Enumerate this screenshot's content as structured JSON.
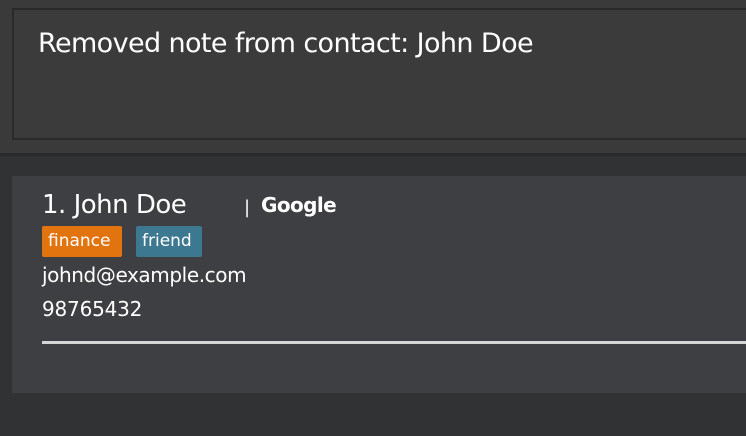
{
  "result": {
    "message": "Removed note from contact: John Doe"
  },
  "person": {
    "index_name": "1. John Doe",
    "separator": "|",
    "company": "Google",
    "tags": [
      {
        "label": "finance",
        "color": "#e2740f"
      },
      {
        "label": "friend",
        "color": "#3d7891"
      }
    ],
    "email": "johnd@example.com",
    "phone": "98765432"
  }
}
